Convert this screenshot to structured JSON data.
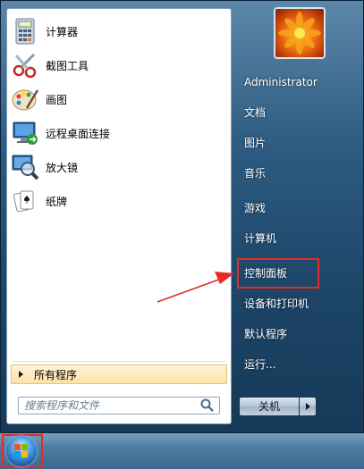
{
  "programs": [
    {
      "label": "计算器",
      "icon": "calculator-icon"
    },
    {
      "label": "截图工具",
      "icon": "snipping-tool-icon"
    },
    {
      "label": "画图",
      "icon": "paint-icon"
    },
    {
      "label": "远程桌面连接",
      "icon": "remote-desktop-icon"
    },
    {
      "label": "放大镜",
      "icon": "magnifier-icon"
    },
    {
      "label": "纸牌",
      "icon": "solitaire-icon"
    }
  ],
  "all_programs_label": "所有程序",
  "search": {
    "placeholder": "搜索程序和文件"
  },
  "user": {
    "name": "Administrator"
  },
  "right_items": [
    {
      "label": "文档"
    },
    {
      "label": "图片"
    },
    {
      "label": "音乐"
    },
    {
      "label": "游戏"
    },
    {
      "label": "计算机"
    },
    {
      "label": "控制面板",
      "highlighted": true
    },
    {
      "label": "设备和打印机"
    },
    {
      "label": "默认程序"
    },
    {
      "label": "运行..."
    }
  ],
  "shutdown": {
    "label": "关机"
  },
  "colors": {
    "highlight_box": "#e52a27",
    "annotation_arrow": "#e52a27"
  }
}
